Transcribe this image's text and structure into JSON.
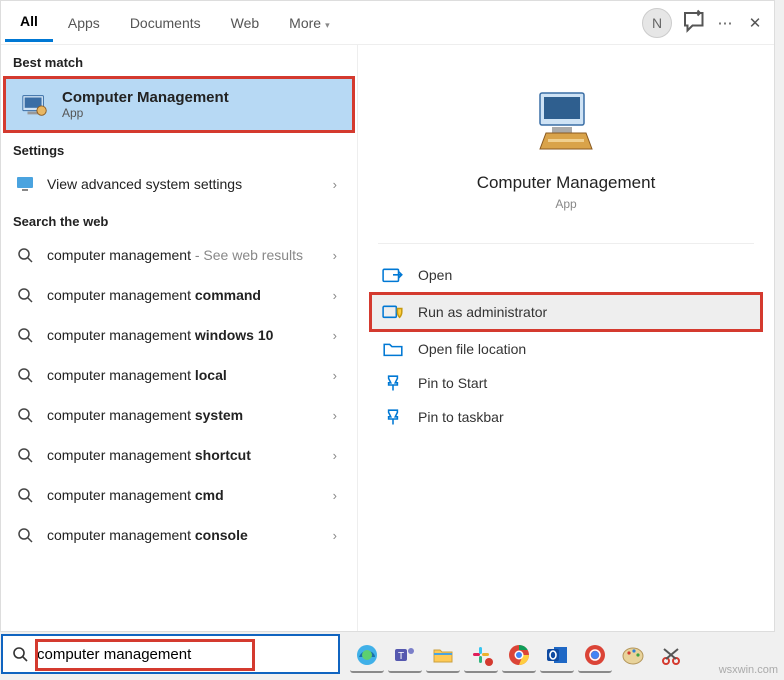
{
  "tabs": {
    "all": "All",
    "apps": "Apps",
    "documents": "Documents",
    "web": "Web",
    "more": "More"
  },
  "avatar_letter": "N",
  "sections": {
    "best_match": "Best match",
    "settings": "Settings",
    "search_web": "Search the web"
  },
  "best_match": {
    "title": "Computer Management",
    "subtitle": "App"
  },
  "settings_row": "View advanced system settings",
  "web": {
    "r1a": "computer management",
    "r1b": " - See web results",
    "r2a": "computer management ",
    "r2b": "command",
    "r3a": "computer management ",
    "r3b": "windows 10",
    "r4a": "computer management ",
    "r4b": "local",
    "r5a": "computer management ",
    "r5b": "system",
    "r6a": "computer management ",
    "r6b": "shortcut",
    "r7a": "computer management ",
    "r7b": "cmd",
    "r8a": "computer management ",
    "r8b": "console"
  },
  "preview": {
    "title": "Computer Management",
    "subtitle": "App"
  },
  "actions": {
    "open": "Open",
    "run_admin": "Run as administrator",
    "open_loc": "Open file location",
    "pin_start": "Pin to Start",
    "pin_taskbar": "Pin to taskbar"
  },
  "search_value": "computer management",
  "watermark": "wsxwin.com"
}
